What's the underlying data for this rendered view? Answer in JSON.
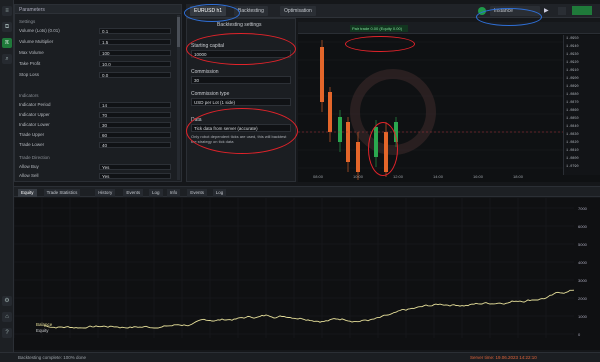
{
  "params": {
    "title": "Parameters",
    "section1": "Settings",
    "rows1": [
      {
        "label": "Volume (Lots) (0.01)",
        "value": "0.1"
      },
      {
        "label": "Volume Multiplier",
        "value": "1.5"
      },
      {
        "label": "Max Volume",
        "value": "100"
      },
      {
        "label": "Take Profit",
        "value": "10.0"
      },
      {
        "label": "Stop Loss",
        "value": "0.0"
      }
    ],
    "section2": "Indicators",
    "rows2": [
      {
        "label": "Indicator Period",
        "value": "14"
      },
      {
        "label": "Indicator Upper",
        "value": "70"
      },
      {
        "label": "Indicator Lower",
        "value": "30"
      },
      {
        "label": "Trade Upper",
        "value": "60"
      },
      {
        "label": "Trade Lower",
        "value": "40"
      }
    ],
    "section3": "Trade Direction",
    "rows3": [
      {
        "label": "Allow Buy",
        "value": "Yes"
      },
      {
        "label": "Allow Sell",
        "value": "Yes"
      }
    ]
  },
  "tabs": {
    "items": [
      "EURUSD h1",
      "Backtesting",
      "Optimisation"
    ],
    "selected_index": 0,
    "instance": "Instance"
  },
  "mid_panel": {
    "title": "Backtesting settings",
    "starting_capital_label": "Starting capital",
    "starting_capital_value": "10000",
    "commission_label": "Commission",
    "commission_value": "30",
    "commission_type_label": "Commission type",
    "commission_type_value": "USD per Lot (1 side)",
    "data_label": "Data",
    "data_value": "Tick data from server (accurate)",
    "note_text": "Only robot dependent ticks are used, this will backtest the strategy on tick data"
  },
  "chart": {
    "balance_label": "Pair trade 0.00 (Equity 0.00)",
    "price_labels": [
      "1.0950",
      "1.0940",
      "1.0930",
      "1.0920",
      "1.0910",
      "1.0900",
      "1.0890",
      "1.0880",
      "1.0870",
      "1.0860",
      "1.0850",
      "1.0840",
      "1.0830",
      "1.0820",
      "1.0810",
      "1.0800",
      "1.0790"
    ],
    "time_labels": [
      "08:00",
      "10:00",
      "12:00",
      "14:00",
      "16:00",
      "18:00"
    ]
  },
  "bottom_tabs": [
    "Equity",
    "Trade Statistics",
    "History",
    "Events",
    "Log",
    "Info",
    "Events",
    "Log"
  ],
  "equity": {
    "legend": [
      "Balance",
      "Equity"
    ],
    "y_labels": [
      "7000",
      "6000",
      "5000",
      "4000",
      "3000",
      "2000",
      "1000",
      "0"
    ]
  },
  "status": {
    "left_text": "Backtesting complete: 100% done",
    "right_text": "Server time: 19.06.2023 14:22:10"
  },
  "colors": {
    "accent": "#1f9a4a",
    "highlight": "#e1232a",
    "equity_line": "#e6df9a",
    "bull": "#2aa84f",
    "bear": "#e4662a"
  }
}
